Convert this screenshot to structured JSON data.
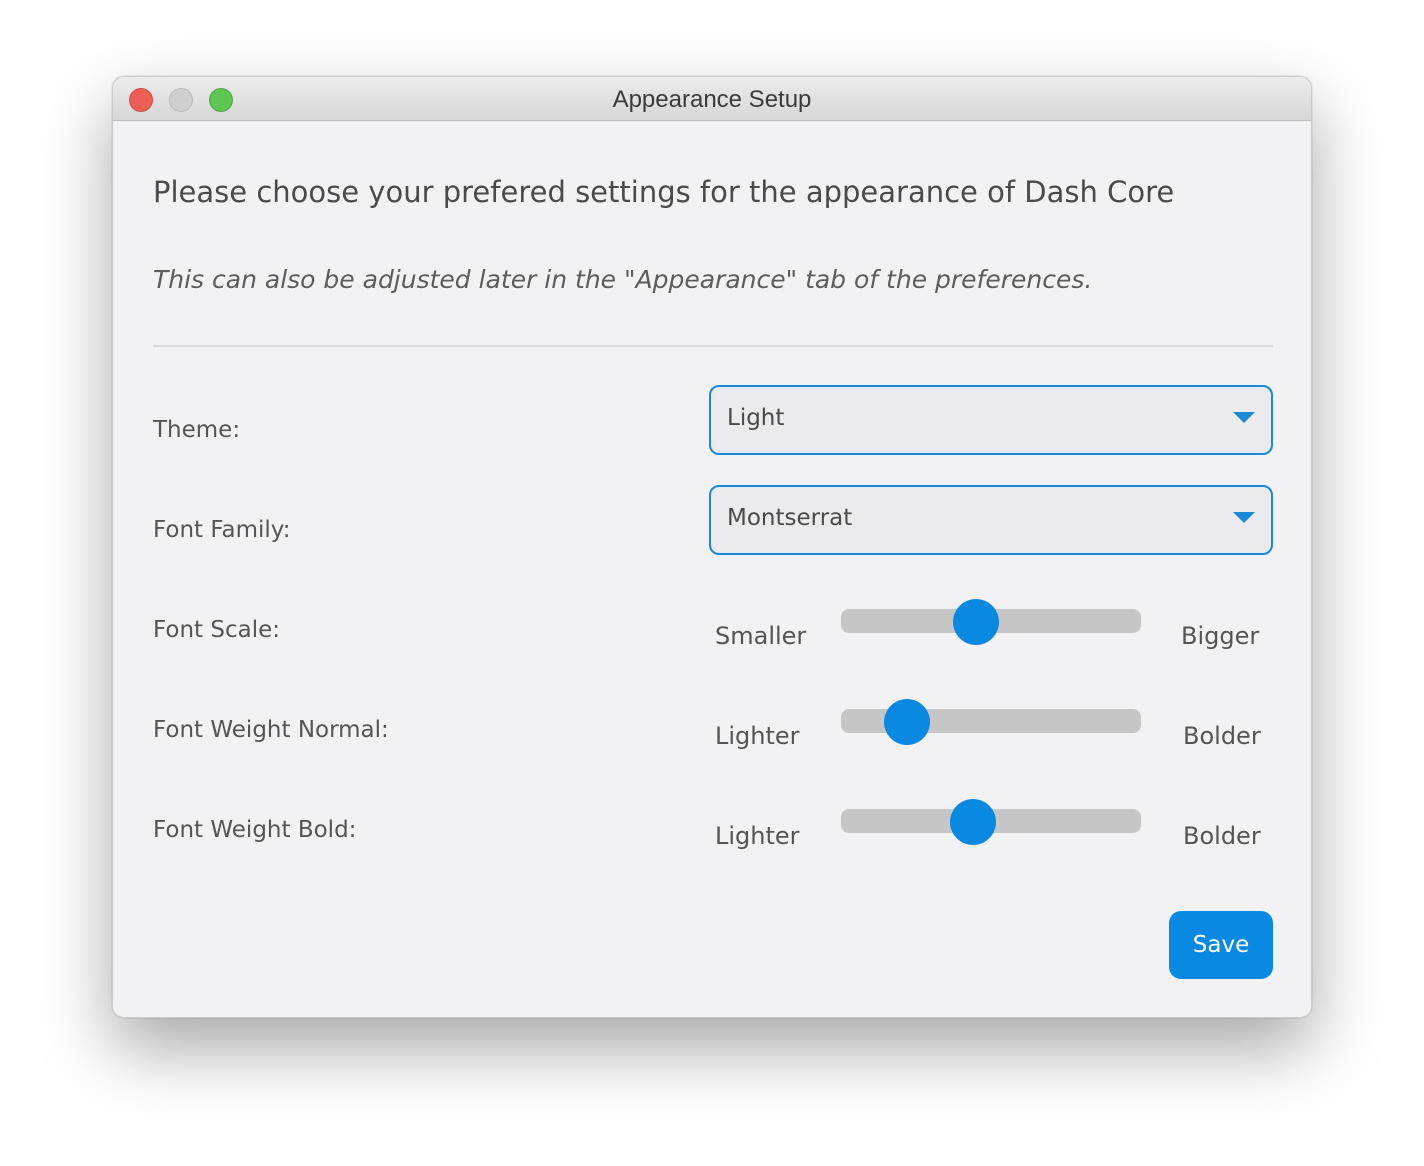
{
  "window": {
    "title": "Appearance Setup"
  },
  "content": {
    "heading": "Please choose your prefered settings for the appearance of Dash Core",
    "subtitle": "This can also be adjusted later in the \"Appearance\" tab of the preferences."
  },
  "theme": {
    "label": "Theme:",
    "selected": "Light"
  },
  "font_family": {
    "label": "Font Family:",
    "selected": "Montserrat"
  },
  "font_scale": {
    "label": "Font Scale:",
    "min_label": "Smaller",
    "max_label": "Bigger",
    "value_fraction": 0.45
  },
  "font_weight_normal": {
    "label": "Font Weight Normal:",
    "min_label": "Lighter",
    "max_label": "Bolder",
    "value_fraction": 0.22
  },
  "font_weight_bold": {
    "label": "Font Weight Bold:",
    "min_label": "Lighter",
    "max_label": "Bolder",
    "value_fraction": 0.44
  },
  "actions": {
    "save_label": "Save"
  },
  "colors": {
    "accent": "#0a89e3",
    "track": "#c6c6c6"
  }
}
